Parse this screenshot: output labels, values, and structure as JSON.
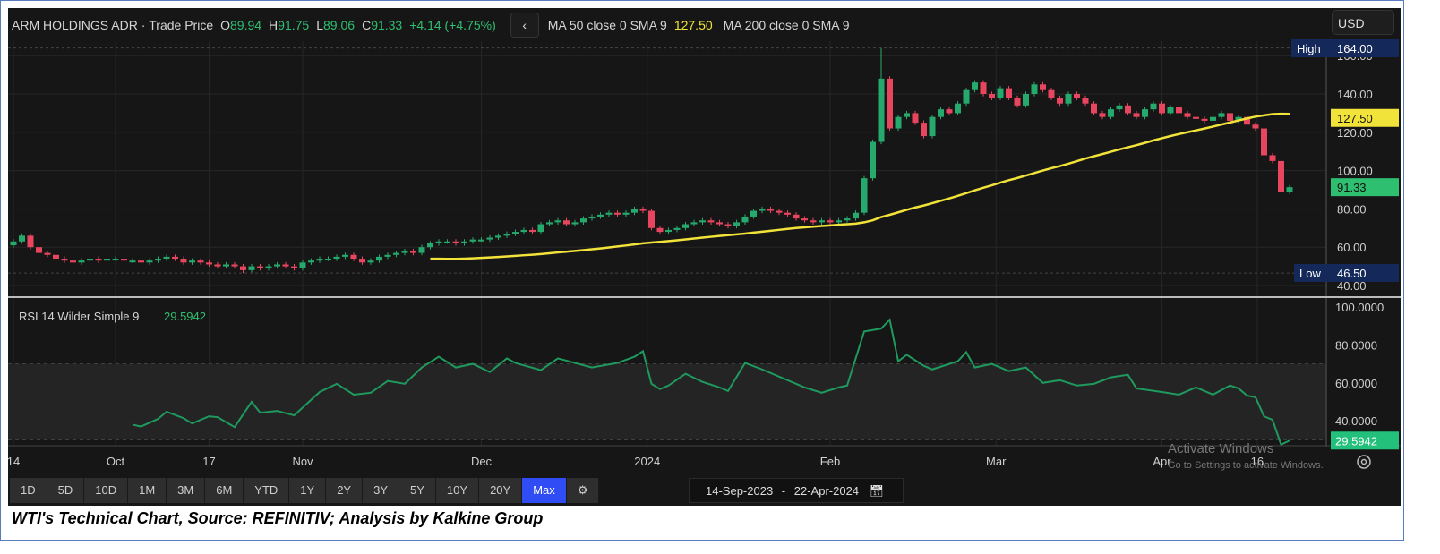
{
  "header": {
    "instrument": "ARM HOLDINGS ADR",
    "separator": "·",
    "series": "Trade Price",
    "o_label": "O",
    "open": "89.94",
    "h_label": "H",
    "high": "91.75",
    "l_label": "L",
    "low": "89.06",
    "c_label": "C",
    "close": "91.33",
    "change": "+4.14 (+4.75%)",
    "back_icon": "‹",
    "ma50_label": "MA 50 close 0 SMA 9",
    "ma50_value": "127.50",
    "ma200_label": "MA 200 close 0 SMA 9"
  },
  "currency": "USD",
  "price_axis": {
    "ticks": [
      "40.00",
      "60.00",
      "80.00",
      "100.00",
      "120.00",
      "140.00",
      "160.00"
    ],
    "high_label": "High",
    "high_value": "164.00",
    "low_label": "Low",
    "low_value": "46.50",
    "ma_tag": "127.50",
    "last_tag": "91.33"
  },
  "rsi": {
    "label": "RSI 14 Wilder Simple 9",
    "value": "29.5942",
    "ticks": [
      "40.0000",
      "60.0000",
      "80.0000",
      "100.0000"
    ],
    "last_tag": "29.5942"
  },
  "x_axis": [
    {
      "label": "14",
      "i": 0
    },
    {
      "label": "Oct",
      "i": 12
    },
    {
      "label": "17",
      "i": 23
    },
    {
      "label": "Nov",
      "i": 34
    },
    {
      "label": "Dec",
      "i": 55
    },
    {
      "label": "2024",
      "i": 74.5
    },
    {
      "label": "Feb",
      "i": 96
    },
    {
      "label": "Mar",
      "i": 115.5
    },
    {
      "label": "Apr",
      "i": 135
    },
    {
      "label": "16",
      "i": 146.2
    }
  ],
  "ranges": [
    "1D",
    "5D",
    "10D",
    "1M",
    "3M",
    "6M",
    "YTD",
    "1Y",
    "2Y",
    "3Y",
    "5Y",
    "10Y",
    "20Y",
    "Max"
  ],
  "active_range": "Max",
  "date_range": {
    "from": "14-Sep-2023",
    "dash": "-",
    "to": "22-Apr-2024"
  },
  "watermark": {
    "line1": "Activate Windows",
    "line2": "Go to Settings to activate Windows."
  },
  "caption": "WTI's Technical Chart, Source: REFINITIV; Analysis by Kalkine Group",
  "colors": {
    "up": "#26a96c",
    "down": "#e8455f",
    "ma": "#f2e33a",
    "rsi": "#1f9a5e",
    "active": "#2f4cf5"
  },
  "chart_data": {
    "type": "candlestick",
    "title": "ARM HOLDINGS ADR - Trade Price",
    "ylim": [
      40,
      164
    ],
    "closes": [
      63,
      66,
      60,
      57,
      56,
      54,
      53,
      52,
      53,
      54,
      53,
      54,
      54,
      53,
      53,
      52,
      53,
      54,
      55,
      54,
      52,
      53,
      52,
      51,
      50,
      51,
      50,
      48,
      50,
      49,
      50,
      51,
      50,
      49,
      52,
      53,
      54,
      54,
      55,
      56,
      54,
      52,
      53,
      55,
      56,
      57,
      58,
      57,
      60,
      62,
      63,
      63,
      62,
      63,
      64,
      64,
      65,
      66,
      67,
      68,
      69,
      68,
      72,
      73,
      74,
      72,
      73,
      75,
      76,
      77,
      78,
      77,
      78,
      80,
      79,
      70,
      68,
      69,
      70,
      72,
      73,
      74,
      73,
      72,
      71,
      73,
      76,
      79,
      80,
      79,
      78,
      77,
      75,
      74,
      73,
      74,
      73,
      74,
      75,
      78,
      96,
      115,
      148,
      122,
      128,
      130,
      125,
      118,
      128,
      132,
      130,
      135,
      142,
      146,
      140,
      138,
      143,
      138,
      134,
      140,
      145,
      142,
      138,
      135,
      140,
      138,
      135,
      130,
      128,
      132,
      134,
      130,
      128,
      132,
      135,
      130,
      133,
      130,
      128,
      127,
      126,
      128,
      130,
      126,
      128,
      124,
      122,
      108,
      105,
      89,
      91.33
    ],
    "high_override": {
      "102": 164
    },
    "low_override": {
      "27": 46.5
    },
    "ma50_period": 50,
    "rsi_ylim": [
      20,
      100
    ],
    "rsi_bands": [
      30,
      70
    ],
    "rsi_points": [
      [
        14,
        38
      ],
      [
        15,
        37
      ],
      [
        17,
        41
      ],
      [
        18,
        44.8
      ],
      [
        20,
        41.4
      ],
      [
        21,
        38.6
      ],
      [
        23,
        42.4
      ],
      [
        24,
        41.9
      ],
      [
        26,
        36.7
      ],
      [
        28,
        50
      ],
      [
        29,
        44.3
      ],
      [
        31,
        45.2
      ],
      [
        33,
        42.9
      ],
      [
        36,
        55.2
      ],
      [
        38,
        59.5
      ],
      [
        40,
        53.8
      ],
      [
        42,
        54.8
      ],
      [
        44,
        61
      ],
      [
        46,
        59.5
      ],
      [
        48,
        68.1
      ],
      [
        50,
        73.8
      ],
      [
        52,
        68.1
      ],
      [
        54,
        70
      ],
      [
        56,
        65.7
      ],
      [
        58,
        72.9
      ],
      [
        59,
        70.5
      ],
      [
        62,
        66.7
      ],
      [
        64,
        72.9
      ],
      [
        66,
        70.5
      ],
      [
        68,
        68.1
      ],
      [
        71,
        70.5
      ],
      [
        73,
        73.8
      ],
      [
        74,
        76.7
      ],
      [
        75,
        59.5
      ],
      [
        76,
        56.7
      ],
      [
        77,
        58.6
      ],
      [
        79,
        64.8
      ],
      [
        81,
        60.5
      ],
      [
        83,
        57.6
      ],
      [
        84,
        55.7
      ],
      [
        86,
        70.5
      ],
      [
        88,
        67.1
      ],
      [
        90,
        63.3
      ],
      [
        93,
        57.6
      ],
      [
        95,
        54.8
      ],
      [
        97,
        57.6
      ],
      [
        98,
        58.6
      ],
      [
        100,
        87.1
      ],
      [
        102,
        88.6
      ],
      [
        103,
        93.3
      ],
      [
        104,
        71.4
      ],
      [
        105,
        74.8
      ],
      [
        107,
        69
      ],
      [
        108,
        67.1
      ],
      [
        111,
        71.4
      ],
      [
        112,
        76.2
      ],
      [
        113,
        68.1
      ],
      [
        115,
        70
      ],
      [
        117,
        66.2
      ],
      [
        119,
        68.1
      ],
      [
        121,
        60
      ],
      [
        123,
        61.4
      ],
      [
        125,
        58.6
      ],
      [
        127,
        59.5
      ],
      [
        129,
        62.9
      ],
      [
        131,
        64.3
      ],
      [
        132,
        57.1
      ],
      [
        135,
        55.2
      ],
      [
        137,
        53.8
      ],
      [
        139,
        57.6
      ],
      [
        141,
        53.8
      ],
      [
        143,
        58.6
      ],
      [
        144,
        57.1
      ],
      [
        145,
        53.3
      ],
      [
        146,
        52.4
      ],
      [
        147,
        42.4
      ],
      [
        148,
        40.5
      ],
      [
        149,
        27.5
      ],
      [
        150,
        29.59
      ]
    ]
  }
}
